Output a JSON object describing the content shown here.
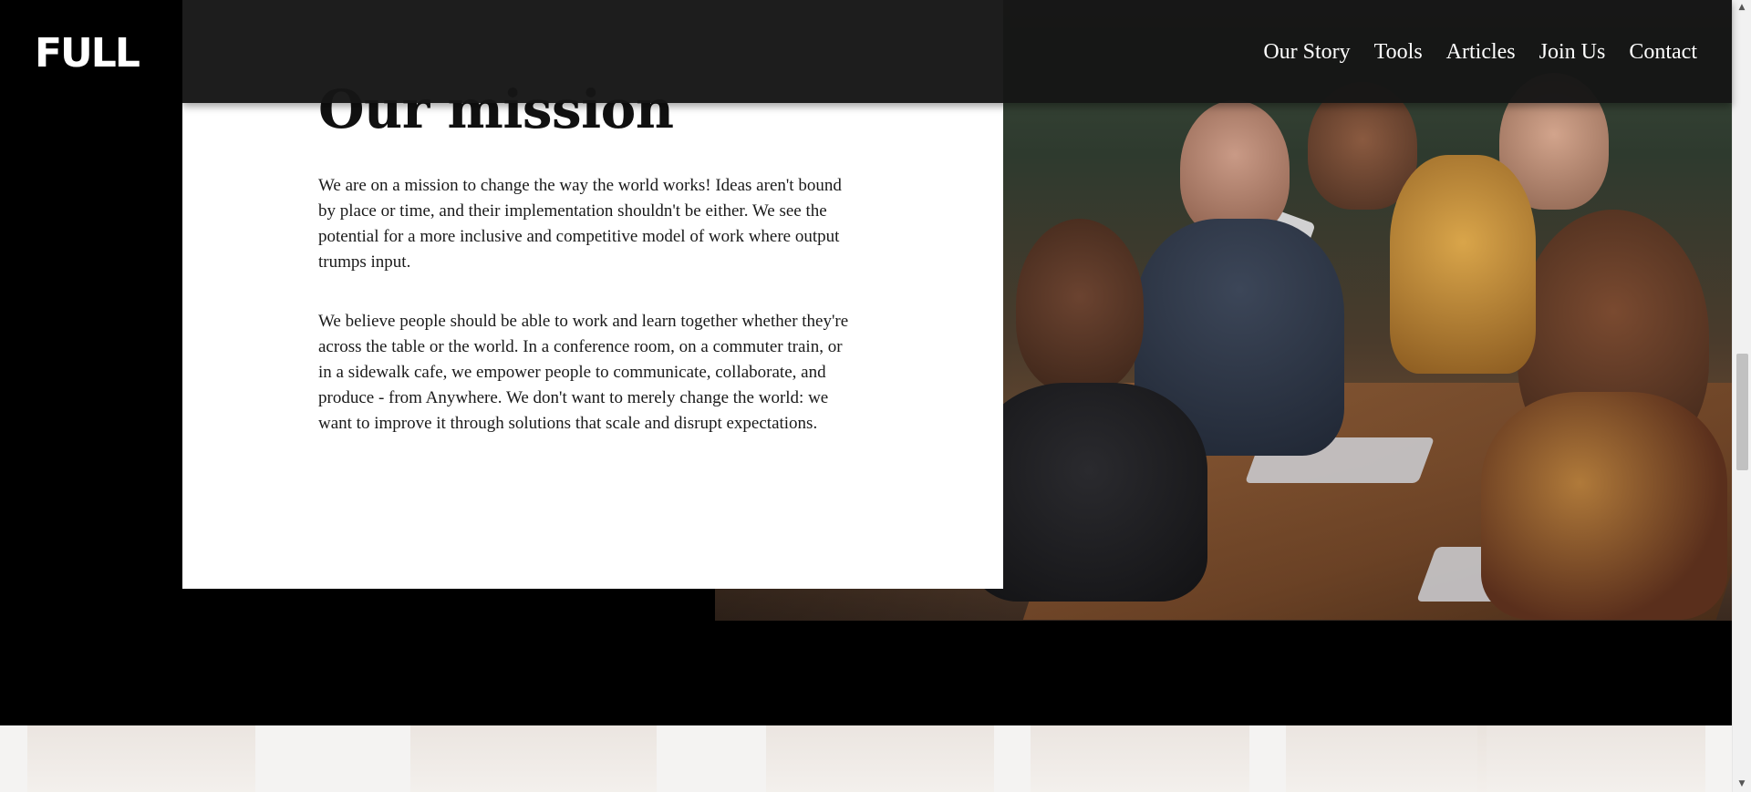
{
  "header": {
    "logo_text": "FULL",
    "nav": [
      {
        "label": "Our Story"
      },
      {
        "label": "Tools"
      },
      {
        "label": "Articles"
      },
      {
        "label": "Join Us"
      },
      {
        "label": "Contact"
      }
    ]
  },
  "mission": {
    "title": "Our mission",
    "paragraphs": [
      "We are on a mission to change the way the world works! Ideas aren't bound by place or time, and their implementation shouldn't be either. We see the potential for a more inclusive and competitive model of work where output trumps input.",
      "We believe people should be able to work and learn together whether they're across the table or the world. In a conference room, on a commuter train, or in a sidewalk cafe, we empower people to communicate, collaborate, and produce - from Anywhere. We don't want to merely change the world: we want to improve it through solutions that scale and disrupt expectations."
    ]
  },
  "scrollbar": {
    "up_icon": "triangle-up",
    "down_icon": "triangle-down"
  },
  "colors": {
    "background": "#000000",
    "header": "#161616",
    "card": "#ffffff",
    "text": "#1a1a1a",
    "nav_text": "#ffffff"
  }
}
